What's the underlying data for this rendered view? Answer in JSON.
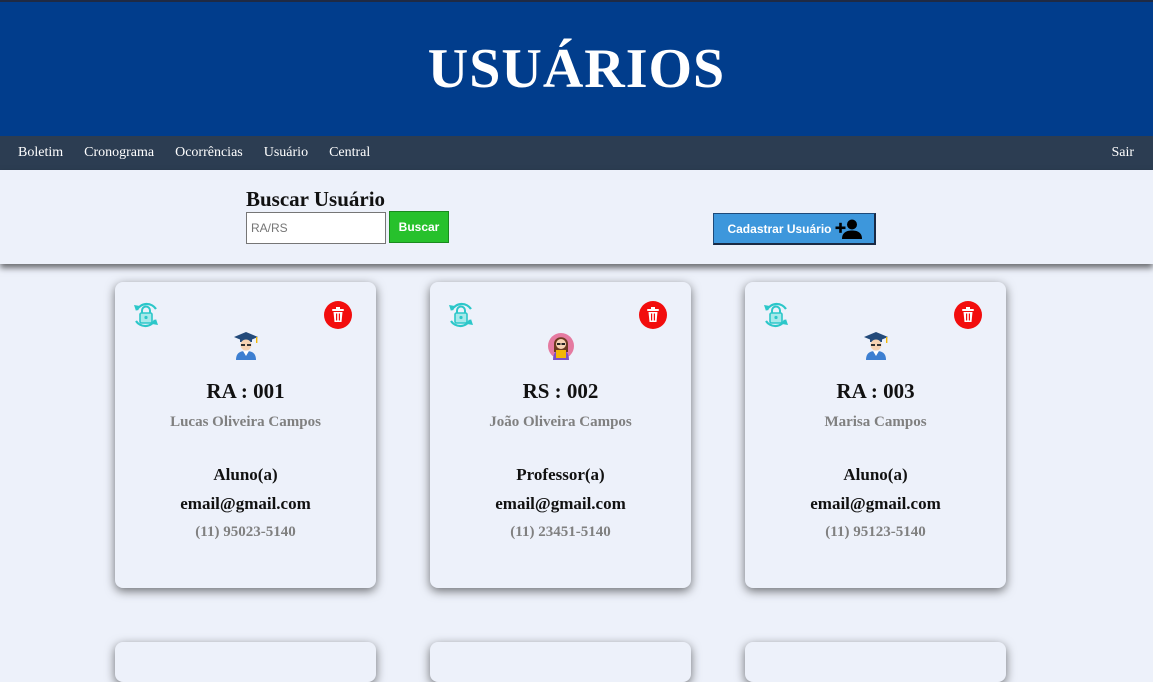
{
  "header": {
    "title": "USUÁRIOS"
  },
  "nav": {
    "items": [
      "Boletim",
      "Cronograma",
      "Ocorrências",
      "Usuário",
      "Central"
    ],
    "logout": "Sair"
  },
  "search": {
    "title": "Buscar Usuário",
    "placeholder": "RA/RS",
    "button": "Buscar"
  },
  "register": {
    "label": "Cadastrar Usuário",
    "icon": "add-user-icon"
  },
  "cards": [
    {
      "id": "RA : 001",
      "name": "Lucas Oliveira Campos",
      "role": "Aluno(a)",
      "email": "email@gmail.com",
      "phone": "(11) 95023-5140",
      "avatar": "student-icon"
    },
    {
      "id": "RS : 002",
      "name": "João Oliveira Campos",
      "role": "Professor(a)",
      "email": "email@gmail.com",
      "phone": "(11) 23451-5140",
      "avatar": "teacher-icon"
    },
    {
      "id": "RA : 003",
      "name": "Marisa Campos",
      "role": "Aluno(a)",
      "email": "email@gmail.com",
      "phone": "(11) 95123-5140",
      "avatar": "student-icon"
    }
  ],
  "colors": {
    "header": "#013d8c",
    "nav": "#2c3d52",
    "background": "#edf1fa",
    "search_button": "#27c12c",
    "register_button": "#3d97dc",
    "delete": "#f20d0d",
    "reset": "#2cc7c9"
  }
}
